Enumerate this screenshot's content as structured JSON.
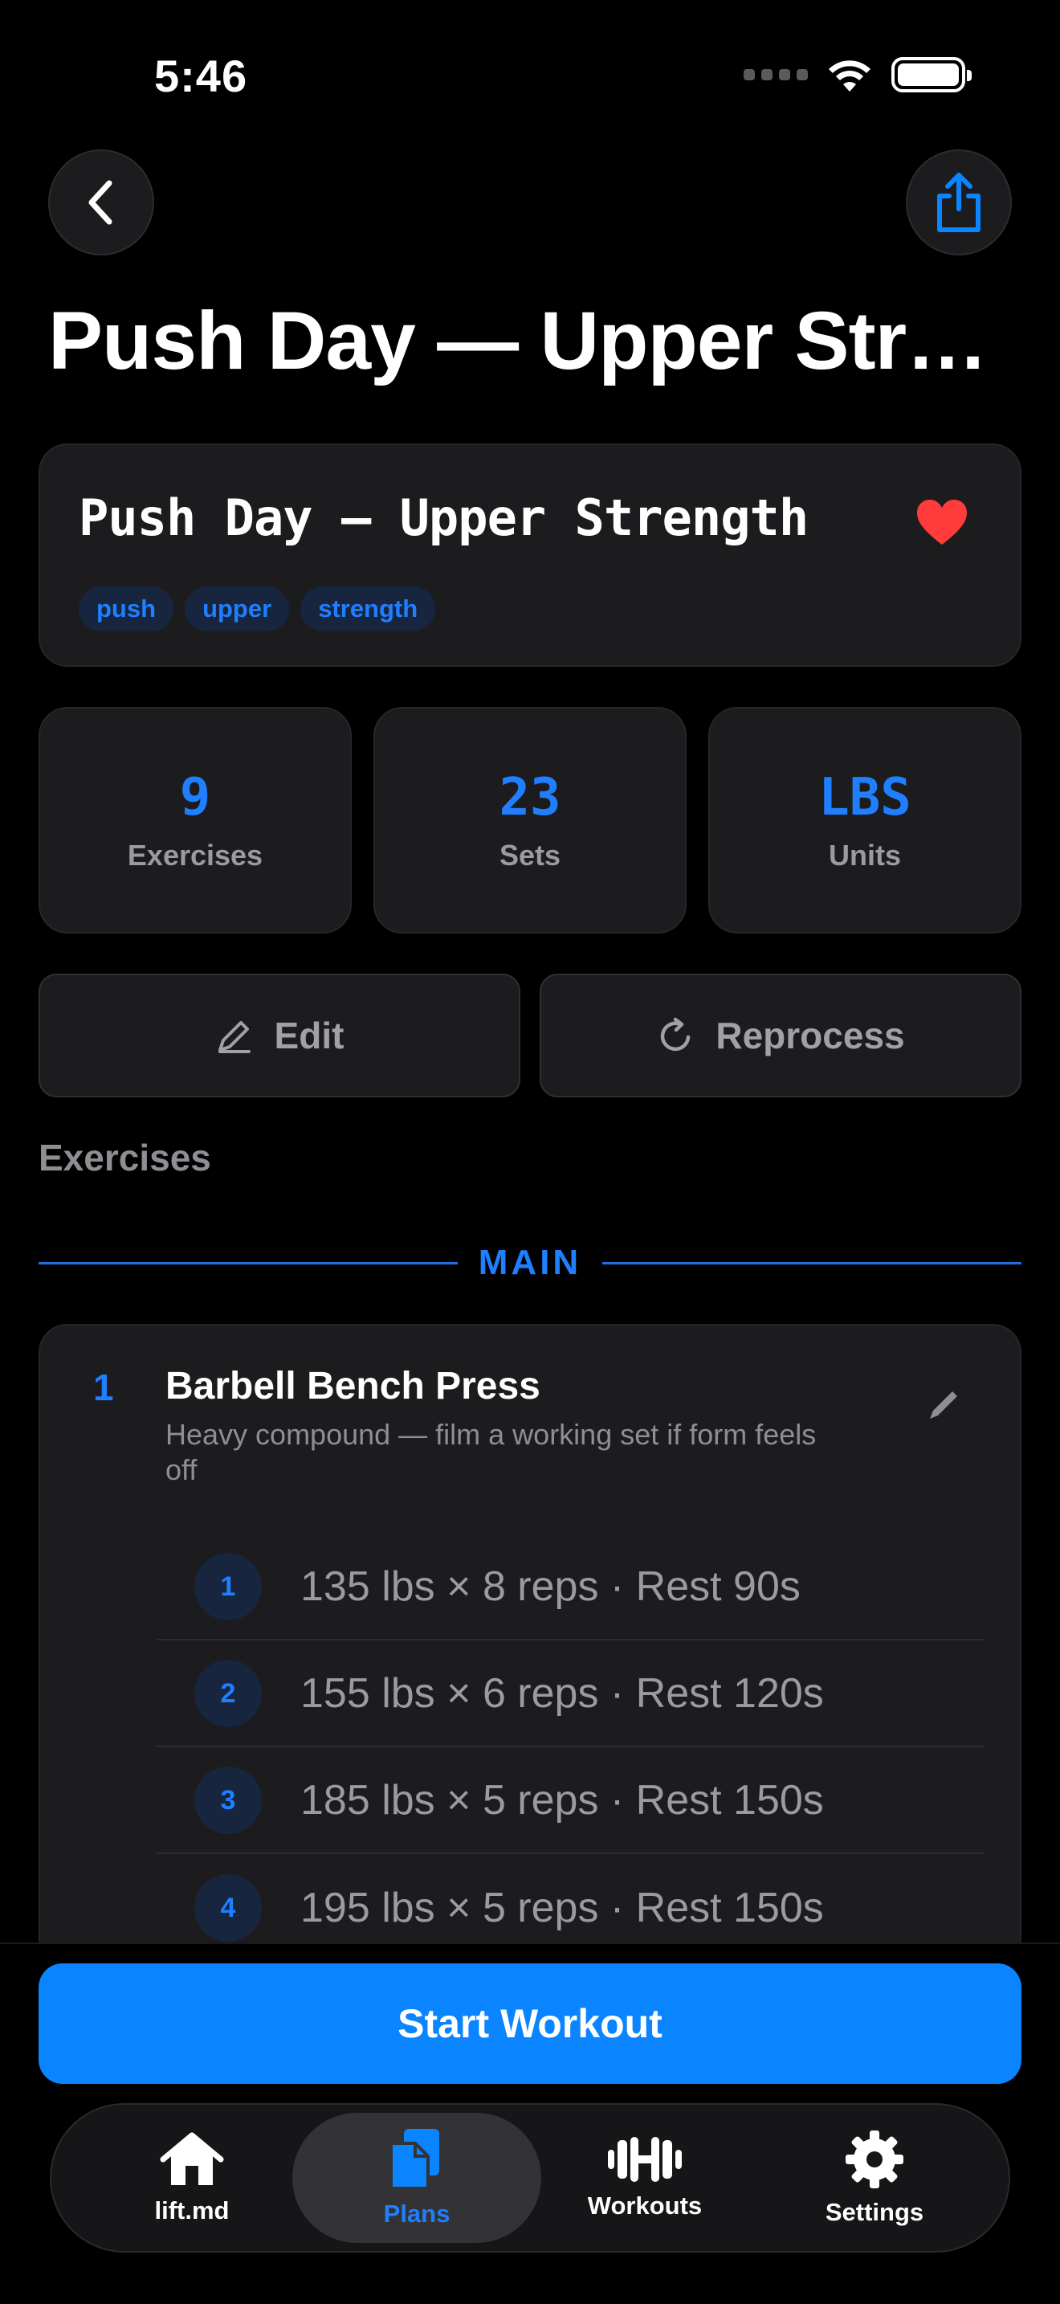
{
  "status_bar": {
    "time": "5:46"
  },
  "page_title": "Push Day — Upper Stren...",
  "plan": {
    "name": "Push Day — Upper Strength",
    "favorite": true,
    "tags": [
      "push",
      "upper",
      "strength"
    ]
  },
  "stats": [
    {
      "value": "9",
      "label": "Exercises"
    },
    {
      "value": "23",
      "label": "Sets"
    },
    {
      "value": "LBS",
      "label": "Units"
    }
  ],
  "actions": {
    "edit_label": "Edit",
    "reprocess_label": "Reprocess"
  },
  "exercises_section": {
    "title": "Exercises",
    "group_label": "MAIN",
    "items": [
      {
        "number": "1",
        "name": "Barbell Bench Press",
        "note": "Heavy compound — film a working set if form feels off",
        "sets": [
          {
            "number": "1",
            "text": "135 lbs × 8 reps · Rest 90s"
          },
          {
            "number": "2",
            "text": "155 lbs × 6 reps · Rest 120s"
          },
          {
            "number": "3",
            "text": "185 lbs × 5 reps · Rest 150s"
          },
          {
            "number": "4",
            "text": "195 lbs × 5 reps · Rest 150s"
          }
        ]
      }
    ]
  },
  "start_button_label": "Start Workout",
  "tabbar": {
    "active": "Plans",
    "tabs": [
      {
        "label": "lift.md",
        "icon": "house-icon"
      },
      {
        "label": "Plans",
        "icon": "documents-icon"
      },
      {
        "label": "Workouts",
        "icon": "dumbbell-icon"
      },
      {
        "label": "Settings",
        "icon": "gear-icon"
      }
    ]
  },
  "colors": {
    "accent": "#0a84ff",
    "accent_text": "#1f7fff",
    "card_bg": "#1c1c1e",
    "heart": "#ff3b3b",
    "background": "#000000"
  }
}
